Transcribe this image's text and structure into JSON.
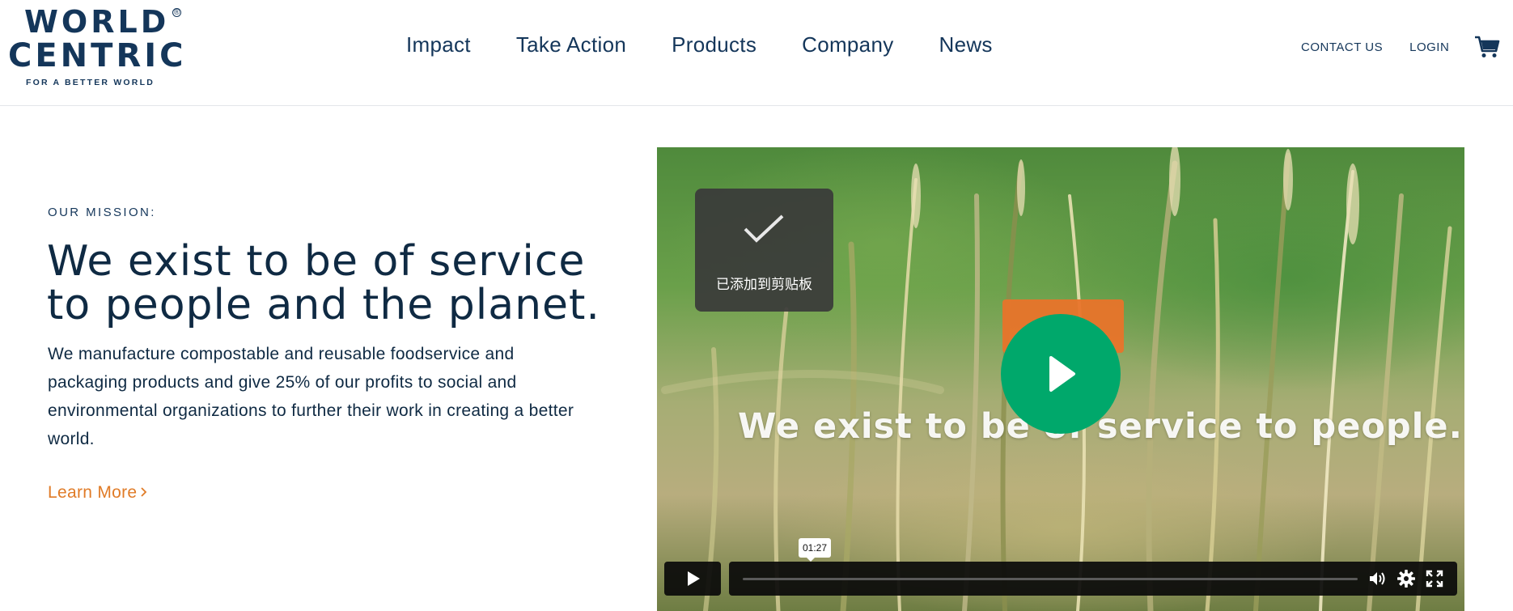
{
  "brand": {
    "line1": "WORLD",
    "line2": "CENTRIC",
    "registered": "®",
    "tagline": "FOR A BETTER WORLD",
    "color": "#14365a"
  },
  "nav": {
    "items": [
      "Impact",
      "Take Action",
      "Products",
      "Company",
      "News"
    ],
    "contact": "CONTACT US",
    "login": "LOGIN",
    "cart_icon": "cart-icon"
  },
  "hero": {
    "eyebrow": "OUR MISSION:",
    "headline": "We exist to be of service to people and the planet.",
    "body": "We manufacture compostable and reusable foodservice and packaging products and give 25% of our profits to social and environmental organizations to further their work in creating a better world.",
    "cta": "Learn More",
    "cta_color": "#e07b27"
  },
  "video": {
    "overlay_text": "We exist to be of service to people.",
    "clipboard_toast": "已添加到剪贴板",
    "time_tooltip": "01:27",
    "progress_fraction": 0,
    "play_button_color": "#00a86b",
    "controls": [
      "play-icon",
      "volume-icon",
      "settings-gear-icon",
      "fullscreen-icon"
    ]
  }
}
